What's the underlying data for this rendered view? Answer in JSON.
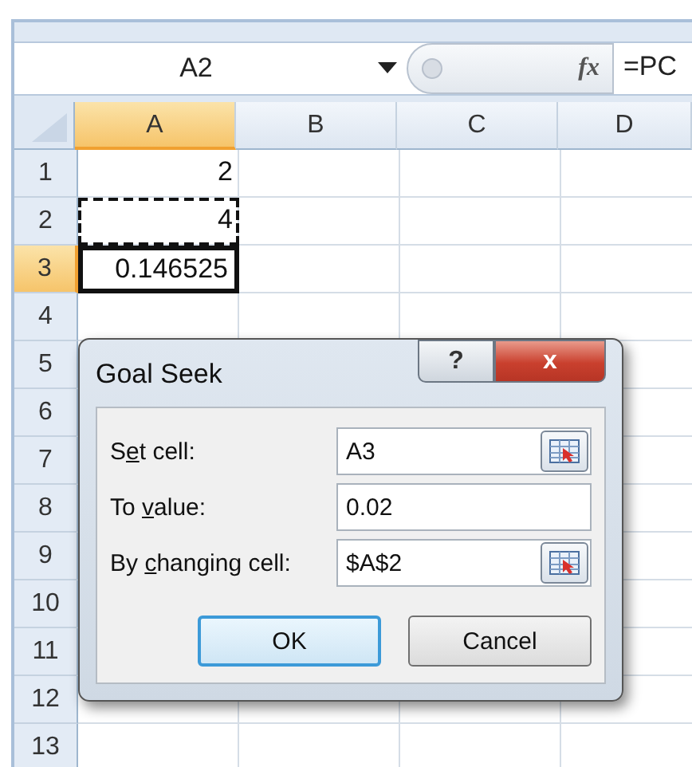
{
  "formula_bar": {
    "name_box": "A2",
    "function_label": "fx",
    "formula": "=PC"
  },
  "columns": [
    {
      "label": "A",
      "selected": true
    },
    {
      "label": "B",
      "selected": false
    },
    {
      "label": "C",
      "selected": false
    },
    {
      "label": "D",
      "selected": false
    }
  ],
  "rows": [
    {
      "label": "1",
      "selected": false,
      "cells": [
        {
          "value": "2",
          "active": false,
          "marquee": false
        }
      ]
    },
    {
      "label": "2",
      "selected": false,
      "cells": [
        {
          "value": "4",
          "active": false,
          "marquee": true
        }
      ]
    },
    {
      "label": "3",
      "selected": true,
      "cells": [
        {
          "value": "0.146525",
          "active": true,
          "marquee": false
        }
      ]
    },
    {
      "label": "4",
      "selected": false,
      "cells": []
    },
    {
      "label": "5",
      "selected": false,
      "cells": []
    },
    {
      "label": "6",
      "selected": false,
      "cells": []
    },
    {
      "label": "7",
      "selected": false,
      "cells": []
    },
    {
      "label": "8",
      "selected": false,
      "cells": []
    },
    {
      "label": "9",
      "selected": false,
      "cells": []
    },
    {
      "label": "10",
      "selected": false,
      "cells": []
    },
    {
      "label": "11",
      "selected": false,
      "cells": []
    },
    {
      "label": "12",
      "selected": false,
      "cells": []
    },
    {
      "label": "13",
      "selected": false,
      "cells": []
    }
  ],
  "dialog": {
    "title": "Goal Seek",
    "help_button": "?",
    "close_button": "x",
    "fields": [
      {
        "label_before": "S",
        "mnemonic": "e",
        "label_after": "t cell:",
        "value": "A3",
        "has_picker": true
      },
      {
        "label_before": "To ",
        "mnemonic": "v",
        "label_after": "alue:",
        "value": "0.02",
        "has_picker": false
      },
      {
        "label_before": "By ",
        "mnemonic": "c",
        "label_after": "hanging cell:",
        "value": "$A$2",
        "has_picker": true
      }
    ],
    "buttons": [
      {
        "label": "OK",
        "default": true
      },
      {
        "label": "Cancel",
        "default": false
      }
    ]
  }
}
